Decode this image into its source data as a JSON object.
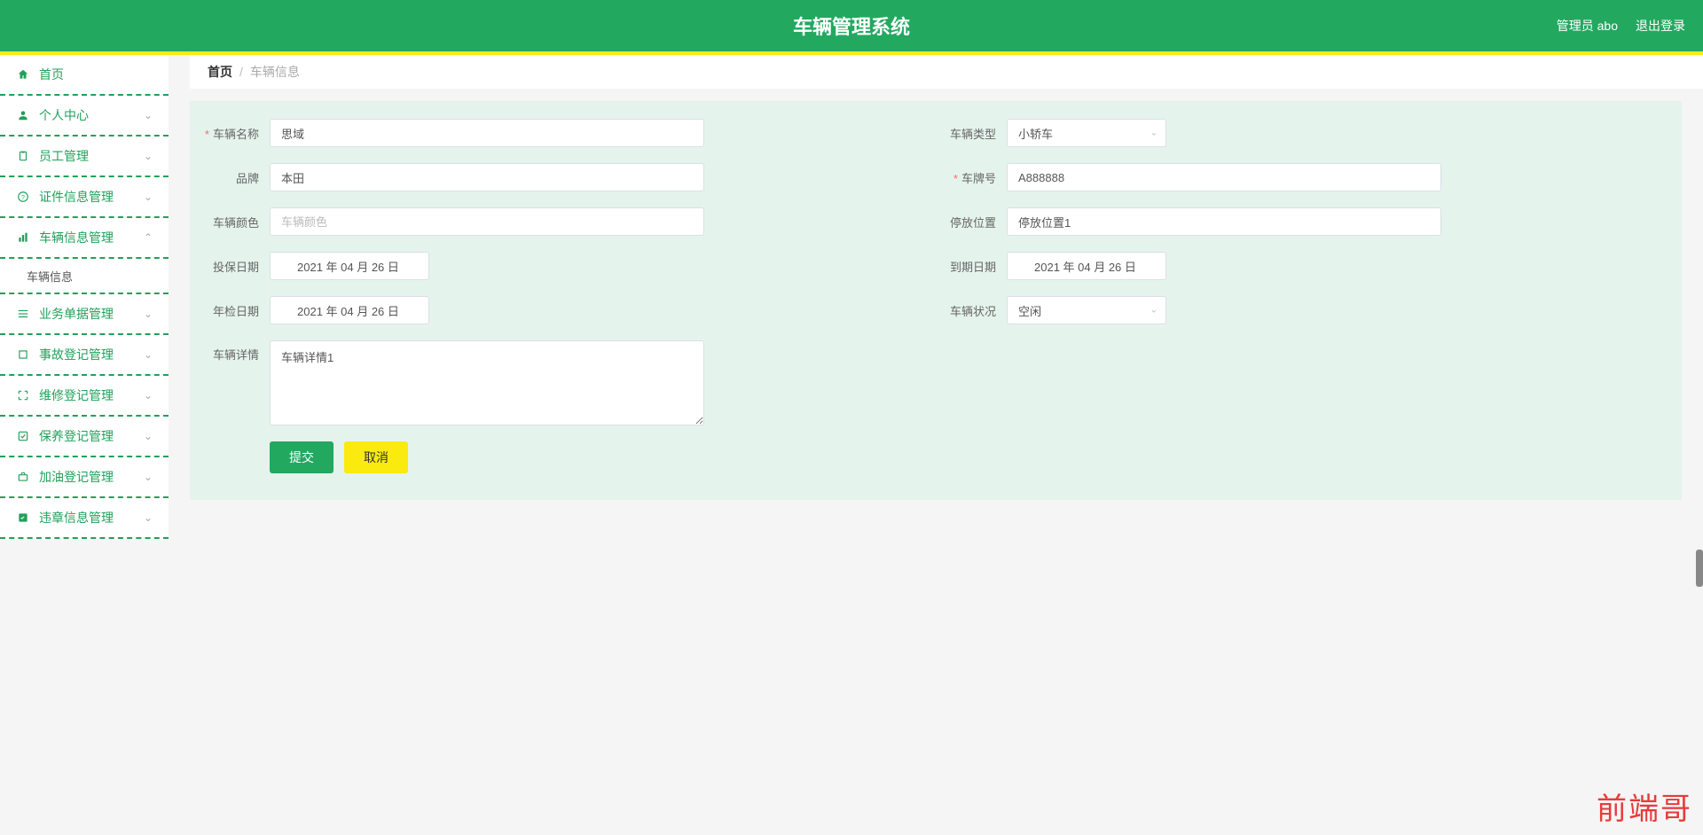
{
  "header": {
    "title": "车辆管理系统",
    "userLabel": "管理员 abo",
    "logoutLabel": "退出登录"
  },
  "sidebar": {
    "items": [
      {
        "label": "首页",
        "icon": "home"
      },
      {
        "label": "个人中心",
        "icon": "user",
        "arrow": true
      },
      {
        "label": "员工管理",
        "icon": "clipboard",
        "arrow": true
      },
      {
        "label": "证件信息管理",
        "icon": "help",
        "arrow": true
      },
      {
        "label": "车辆信息管理",
        "icon": "bar",
        "arrow": true,
        "expanded": true
      },
      {
        "label": "业务单据管理",
        "icon": "menu",
        "arrow": true
      },
      {
        "label": "事故登记管理",
        "icon": "crop",
        "arrow": true
      },
      {
        "label": "维修登记管理",
        "icon": "expand",
        "arrow": true
      },
      {
        "label": "保养登记管理",
        "icon": "check-square",
        "arrow": true
      },
      {
        "label": "加油登记管理",
        "icon": "briefcase",
        "arrow": true
      },
      {
        "label": "违章信息管理",
        "icon": "check-list",
        "arrow": true
      }
    ],
    "subItem": "车辆信息"
  },
  "breadcrumb": {
    "home": "首页",
    "current": "车辆信息"
  },
  "form": {
    "vehicleName": {
      "label": "车辆名称",
      "value": "思域"
    },
    "vehicleType": {
      "label": "车辆类型",
      "value": "小轿车"
    },
    "brand": {
      "label": "品牌",
      "value": "本田"
    },
    "plate": {
      "label": "车牌号",
      "value": "A888888"
    },
    "color": {
      "label": "车辆颜色",
      "placeholder": "车辆颜色",
      "value": ""
    },
    "park": {
      "label": "停放位置",
      "value": "停放位置1"
    },
    "insureDate": {
      "label": "投保日期",
      "value": "2021 年 04 月 26 日"
    },
    "expireDate": {
      "label": "到期日期",
      "value": "2021 年 04 月 26 日"
    },
    "inspectDate": {
      "label": "年检日期",
      "value": "2021 年 04 月 26 日"
    },
    "status": {
      "label": "车辆状况",
      "value": "空闲"
    },
    "detail": {
      "label": "车辆详情",
      "value": "车辆详情1"
    }
  },
  "buttons": {
    "submit": "提交",
    "cancel": "取消"
  },
  "watermark": "前端哥"
}
